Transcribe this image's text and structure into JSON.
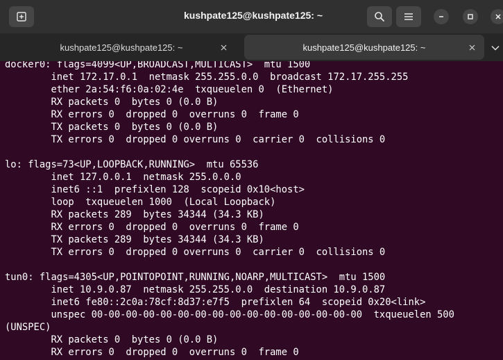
{
  "window": {
    "title": "kushpate125@kushpate125: ~"
  },
  "header": {
    "icons": {
      "new_tab": "new-tab-icon",
      "search": "search-icon",
      "menu": "hamburger-menu-icon",
      "minimize": "minimize-icon",
      "maximize": "maximize-icon",
      "close": "close-icon"
    }
  },
  "tabs": [
    {
      "label": "kushpate125@kushpate125: ~",
      "active": false
    },
    {
      "label": "kushpate125@kushpate125: ~",
      "active": true
    }
  ],
  "colors": {
    "terminal_bg": "#300a24",
    "header_bg": "#303030",
    "tabbar_bg": "#262626",
    "active_tab_bg": "#3a3a3a",
    "text": "#ffffff"
  },
  "terminal": {
    "lines": [
      "docker0: flags=4099<UP,BROADCAST,MULTICAST>  mtu 1500",
      "        inet 172.17.0.1  netmask 255.255.0.0  broadcast 172.17.255.255",
      "        ether 2a:54:f6:0a:02:4e  txqueuelen 0  (Ethernet)",
      "        RX packets 0  bytes 0 (0.0 B)",
      "        RX errors 0  dropped 0  overruns 0  frame 0",
      "        TX packets 0  bytes 0 (0.0 B)",
      "        TX errors 0  dropped 0 overruns 0  carrier 0  collisions 0",
      "",
      "lo: flags=73<UP,LOOPBACK,RUNNING>  mtu 65536",
      "        inet 127.0.0.1  netmask 255.0.0.0",
      "        inet6 ::1  prefixlen 128  scopeid 0x10<host>",
      "        loop  txqueuelen 1000  (Local Loopback)",
      "        RX packets 289  bytes 34344 (34.3 KB)",
      "        RX errors 0  dropped 0  overruns 0  frame 0",
      "        TX packets 289  bytes 34344 (34.3 KB)",
      "        TX errors 0  dropped 0 overruns 0  carrier 0  collisions 0",
      "",
      "tun0: flags=4305<UP,POINTOPOINT,RUNNING,NOARP,MULTICAST>  mtu 1500",
      "        inet 10.9.0.87  netmask 255.255.0.0  destination 10.9.0.87",
      "        inet6 fe80::2c0a:78cf:8d37:e7f5  prefixlen 64  scopeid 0x20<link>",
      "        unspec 00-00-00-00-00-00-00-00-00-00-00-00-00-00-00-00  txqueuelen 500",
      "(UNSPEC)",
      "        RX packets 0  bytes 0 (0.0 B)",
      "        RX errors 0  dropped 0  overruns 0  frame 0"
    ]
  }
}
